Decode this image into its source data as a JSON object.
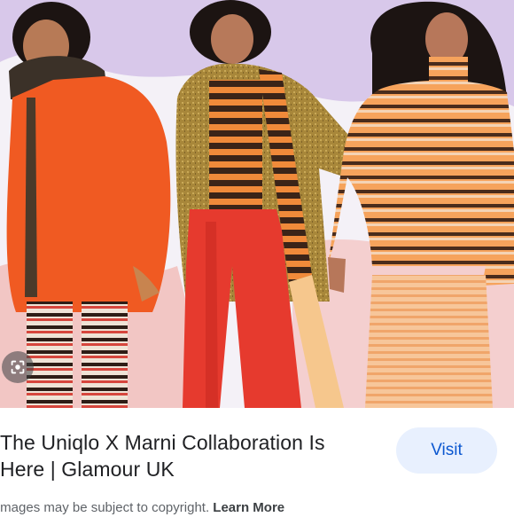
{
  "result": {
    "title": "The Uniqlo X Marni Collaboration Is Here | Glamour UK",
    "title_line1": "The Uniqlo X Marni Collaboration Is",
    "title_line2": "Here | Glamour UK",
    "visit_label": "Visit",
    "copyright_notice": "Images may be subject to copyright.",
    "learn_more_label": "Learn More"
  },
  "image": {
    "lens_icon": "google-lens-icon"
  },
  "colors": {
    "visit_bg": "#e8f0fe",
    "visit_text": "#0b57d0",
    "title_text": "#202124",
    "notice_text": "#5f6368"
  }
}
